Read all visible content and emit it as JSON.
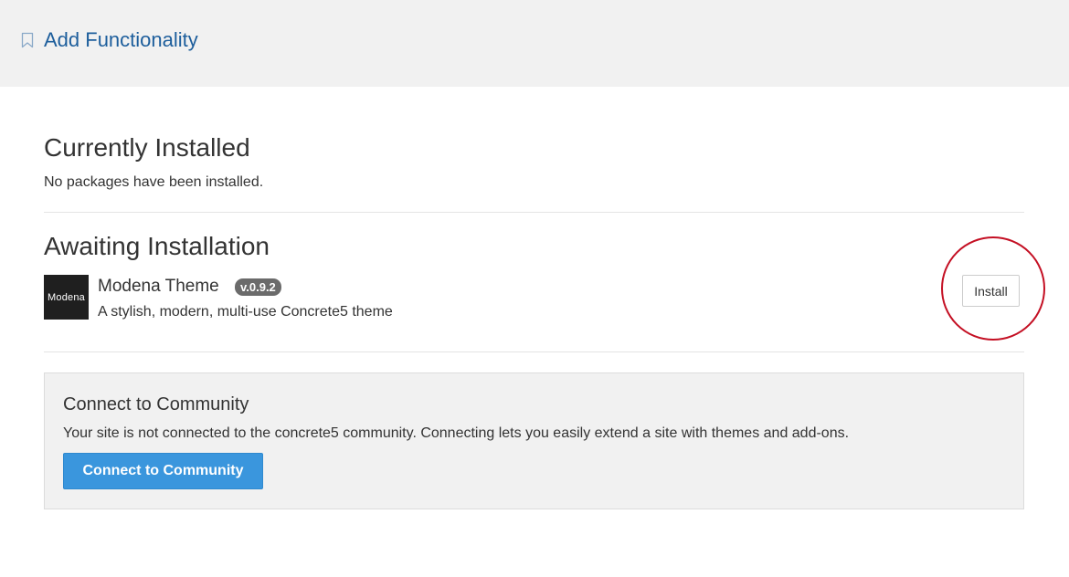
{
  "header": {
    "title": "Add Functionality",
    "icon": "bookmark-icon",
    "background": "#f1f1f1",
    "title_color": "#1d5e9c"
  },
  "installed": {
    "heading": "Currently Installed",
    "empty_message": "No packages have been installed."
  },
  "awaiting": {
    "heading": "Awaiting Installation",
    "packages": [
      {
        "thumb_label": "Modena",
        "name": "Modena Theme",
        "version": "v.0.9.2",
        "description": "A stylish, modern, multi-use Concrete5 theme",
        "install_label": "Install"
      }
    ],
    "highlight_color": "#c40f23"
  },
  "community": {
    "title": "Connect to Community",
    "text": "Your site is not connected to the concrete5 community. Connecting lets you easily extend a site with themes and add-ons.",
    "button_label": "Connect to Community",
    "button_color": "#3a96dd"
  }
}
